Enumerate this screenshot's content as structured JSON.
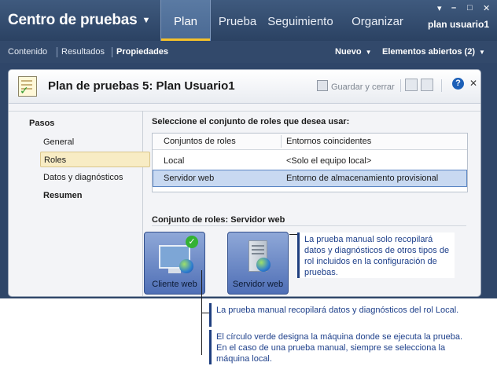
{
  "header": {
    "app_title": "Centro de pruebas",
    "nav": [
      "Plan",
      "Prueba",
      "Seguimiento",
      "Organizar"
    ],
    "active_nav": "Plan",
    "user": "plan usuario1",
    "window_controls": [
      "▾",
      "–",
      "□",
      "✕"
    ]
  },
  "subnav": {
    "items": [
      "Contenido",
      "Resultados",
      "Propiedades"
    ],
    "active": "Propiedades",
    "right_new": "Nuevo",
    "right_open": "Elementos abiertos (2)"
  },
  "panel": {
    "title": "Plan de pruebas 5: Plan Usuario1",
    "save_close": "Guardar y cerrar",
    "help": "?",
    "close": "✕"
  },
  "steps": {
    "title": "Pasos",
    "items": [
      {
        "label": "General",
        "selected": false,
        "bold": false
      },
      {
        "label": "Roles",
        "selected": true,
        "bold": false
      },
      {
        "label": "Datos y diagnósticos",
        "selected": false,
        "bold": false
      },
      {
        "label": "Resumen",
        "selected": false,
        "bold": true
      }
    ]
  },
  "roles": {
    "instruction": "Seleccione el conjunto de roles que desea usar:",
    "columns": [
      "Conjuntos de roles",
      "Entornos coincidentes"
    ],
    "rows": [
      {
        "set": "Local",
        "env": "<Solo el equipo local>",
        "selected": false
      },
      {
        "set": "Servidor web",
        "env": "Entorno de almacenamiento provisional",
        "selected": true
      }
    ]
  },
  "role_set": {
    "title": "Conjunto de roles: Servidor web",
    "tiles": [
      {
        "label": "Cliente web",
        "icon": "computer-icon",
        "checked": true
      },
      {
        "label": "Servidor web",
        "icon": "server-icon",
        "checked": false
      }
    ]
  },
  "callouts": {
    "tiles_note": "La prueba manual solo recopilará datos y diagnósticos de otros tipos de rol incluidos en la configuración de pruebas.",
    "local_note": "La prueba manual recopilará datos y diagnósticos del rol Local.",
    "green_note": "El círculo verde designa la máquina donde se ejecuta la prueba. En el caso de una prueba manual, siempre se selecciona la máquina local."
  },
  "colors": {
    "header_bg": "#2b4263",
    "accent_underline": "#f4c12b",
    "selection": "#c8d9f1",
    "callout_text": "#1d3f8a"
  }
}
